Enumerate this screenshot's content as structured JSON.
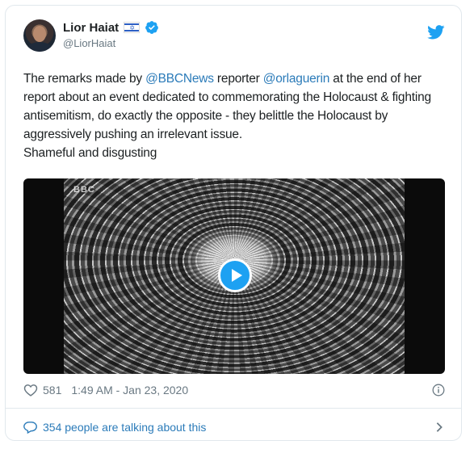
{
  "tweet": {
    "author": {
      "display_name": "Lior Haiat",
      "handle": "@LiorHaiat",
      "flag": "israel-flag",
      "verified": true
    },
    "text": {
      "t1": "The remarks made by ",
      "m1": "@BBCNews",
      "t2": " reporter ",
      "m2": "@orlaguerin",
      "t3": " at the end of her report about an event dedicated to commemorating the Holocaust & fighting antisemitism, do exactly the opposite - they belittle the Holocaust by aggressively pushing an irrelevant issue.",
      "t4": "Shameful and disgusting"
    },
    "media": {
      "type": "video",
      "watermark": "BBC",
      "play_icon": "play-icon"
    },
    "likes": "581",
    "timestamp": "1:49 AM - Jan 23, 2020",
    "conversation": "354 people are talking about this"
  },
  "colors": {
    "accent": "#1da1f2",
    "link": "#2b7bb9",
    "muted": "#697882",
    "text": "#1c2022",
    "border": "#e1e8ed"
  }
}
